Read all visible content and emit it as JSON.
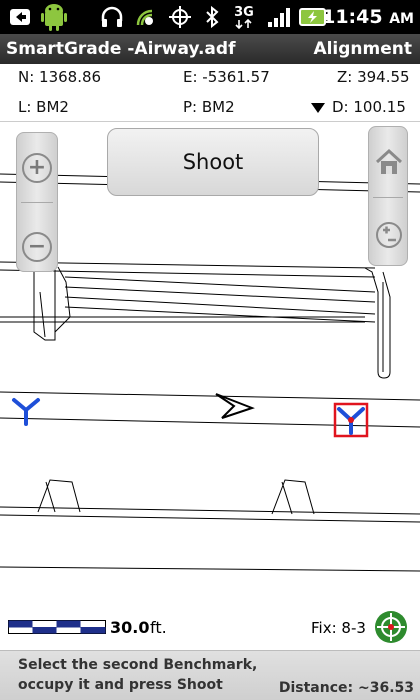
{
  "status_bar": {
    "time": "11:45",
    "time_suffix": "AM",
    "network": "3G",
    "icons": [
      "usb-icon",
      "android-debug-icon",
      "headset-icon",
      "wifi-calling-icon",
      "gps-target-icon",
      "bluetooth-icon",
      "network-3g-icon",
      "signal-icon",
      "battery-charging-icon"
    ]
  },
  "titlebar": {
    "app_title": "SmartGrade -Airway.adf",
    "mode": "Alignment"
  },
  "info": {
    "n": "N: 1368.86",
    "e": "E: -5361.57",
    "z": "Z: 394.55",
    "l": "L:  BM2",
    "p": "P:  BM2",
    "d": "D: 100.15"
  },
  "map": {
    "shoot_label": "Shoot",
    "benchmark_color": "#1e4fd8",
    "selected_color": "#e0141e"
  },
  "scale": {
    "value": "30.0",
    "unit": "ft."
  },
  "fix": {
    "text": "Fix: 8-3"
  },
  "bottom": {
    "prompt_line1": "Select the second Benchmark,",
    "prompt_line2": "occupy it and press Shoot",
    "distance": "Distance: ~36.53"
  }
}
